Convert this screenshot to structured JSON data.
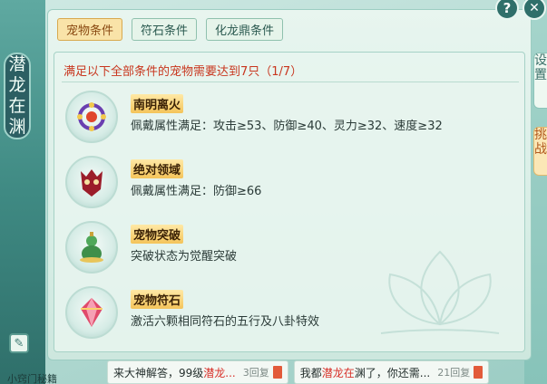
{
  "side": {
    "title_chars": [
      "潜",
      "龙",
      "在",
      "渊"
    ],
    "bottom_label": "小窍门秘籍",
    "right_tabs": [
      "设置",
      "挑战"
    ]
  },
  "buttons": {
    "help": "?",
    "close": "✕"
  },
  "tabs": [
    {
      "label": "宠物条件",
      "active": true
    },
    {
      "label": "符石条件",
      "active": false
    },
    {
      "label": "化龙鼎条件",
      "active": false
    }
  ],
  "headline": "满足以下全部条件的宠物需要达到7只（1/7）",
  "conditions": [
    {
      "name": "南明离火",
      "desc": "佩戴属性满足：攻击≥53、防御≥40、灵力≥32、速度≥32"
    },
    {
      "name": "绝对领域",
      "desc": "佩戴属性满足：防御≥66"
    },
    {
      "name": "宠物突破",
      "desc": "突破状态为觉醒突破"
    },
    {
      "name": "宠物符石",
      "desc": "激活六颗相同符石的五行及八卦特效"
    }
  ],
  "chat": [
    {
      "pre": "来大神解答，99级",
      "hl": "潜龙...",
      "count": "3回复"
    },
    {
      "pre": "我都",
      "hl": "潜龙在",
      "post": "渊了，你还需...",
      "count": "21回复"
    }
  ]
}
